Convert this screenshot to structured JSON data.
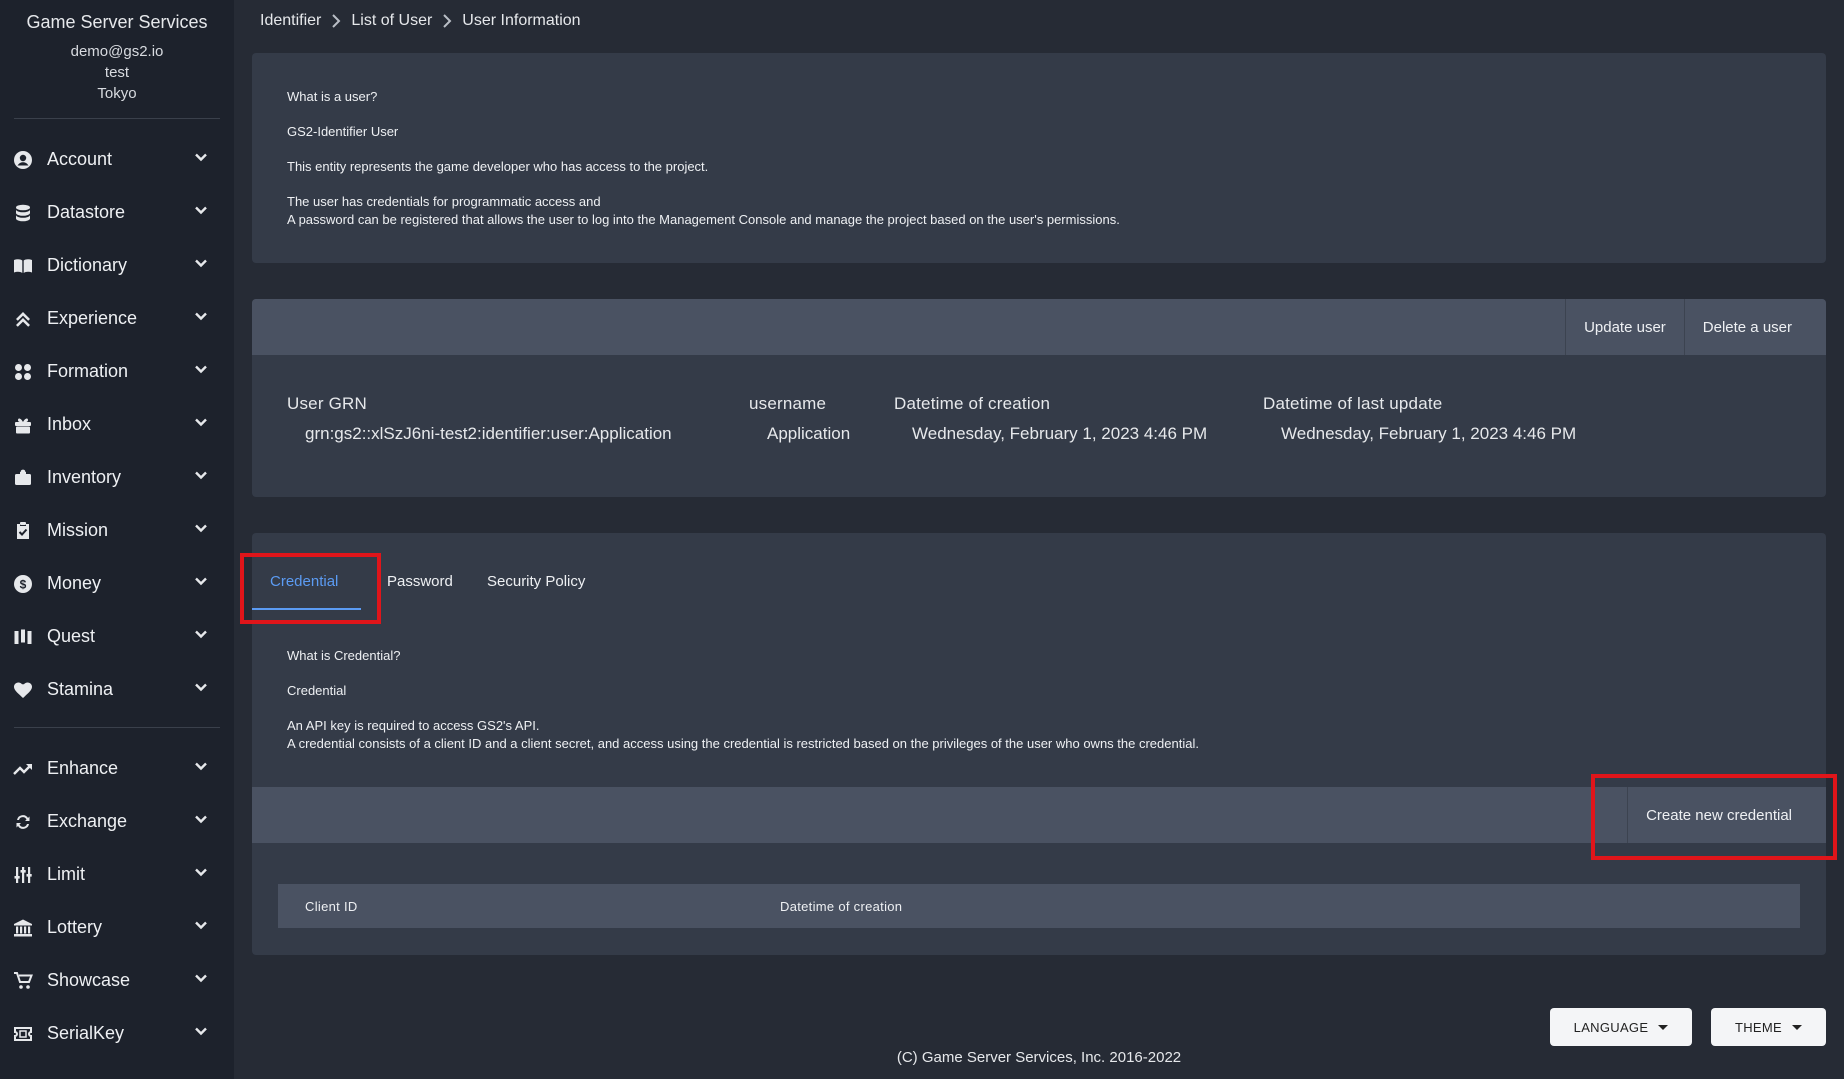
{
  "sidebar": {
    "brand": "Game Server Services",
    "email": "demo@gs2.io",
    "project": "test",
    "region": "Tokyo",
    "group1": [
      {
        "label": "Account",
        "icon": "account-circle-icon"
      },
      {
        "label": "Datastore",
        "icon": "database-icon"
      },
      {
        "label": "Dictionary",
        "icon": "book-open-icon"
      },
      {
        "label": "Experience",
        "icon": "chevron-double-up-icon"
      },
      {
        "label": "Formation",
        "icon": "grid-icon"
      },
      {
        "label": "Inbox",
        "icon": "gift-icon"
      },
      {
        "label": "Inventory",
        "icon": "briefcase-icon"
      },
      {
        "label": "Mission",
        "icon": "clipboard-check-icon"
      },
      {
        "label": "Money",
        "icon": "dollar-circle-icon"
      },
      {
        "label": "Quest",
        "icon": "map-icon"
      },
      {
        "label": "Stamina",
        "icon": "heart-icon"
      }
    ],
    "group2": [
      {
        "label": "Enhance",
        "icon": "trending-up-icon"
      },
      {
        "label": "Exchange",
        "icon": "swap-icon"
      },
      {
        "label": "Limit",
        "icon": "sliders-icon"
      },
      {
        "label": "Lottery",
        "icon": "bank-icon"
      },
      {
        "label": "Showcase",
        "icon": "cart-icon"
      },
      {
        "label": "SerialKey",
        "icon": "ticket-icon"
      }
    ]
  },
  "breadcrumb": [
    "Identifier",
    "List of User",
    "User Information"
  ],
  "info": {
    "q": "What is a user?",
    "title": "GS2-Identifier User",
    "p1": "This entity represents the game developer who has access to the project.",
    "p2": "The user has credentials for programmatic access and",
    "p3": "A password can be registered that allows the user to log into the Management Console and manage the project based on the user's permissions."
  },
  "user": {
    "update_label": "Update user",
    "delete_label": "Delete a user",
    "grn_label": "User GRN",
    "grn_value": "grn:gs2::xlSzJ6ni-test2:identifier:user:Application",
    "username_label": "username",
    "username_value": "Application",
    "created_label": "Datetime of creation",
    "created_value": "Wednesday, February 1, 2023 4:46 PM",
    "updated_label": "Datetime of last update",
    "updated_value": "Wednesday, February 1, 2023 4:46 PM"
  },
  "tabs": {
    "credential": "Credential",
    "password": "Password",
    "security_policy": "Security Policy",
    "active": "Credential"
  },
  "credential": {
    "q": "What is Credential?",
    "title": "Credential",
    "p1": "An API key is required to access GS2's API.",
    "p2": "A credential consists of a client ID and a client secret, and access using the credential is restricted based on the privileges of the user who owns the credential.",
    "create_label": "Create new credential",
    "col_client_id": "Client ID",
    "col_created": "Datetime of creation"
  },
  "footer": {
    "language": "LANGUAGE",
    "theme": "THEME",
    "copyright": "(C) Game Server Services, Inc. 2016-2022"
  },
  "colors": {
    "accent": "#5b9bf3",
    "highlight": "#e0151a"
  }
}
